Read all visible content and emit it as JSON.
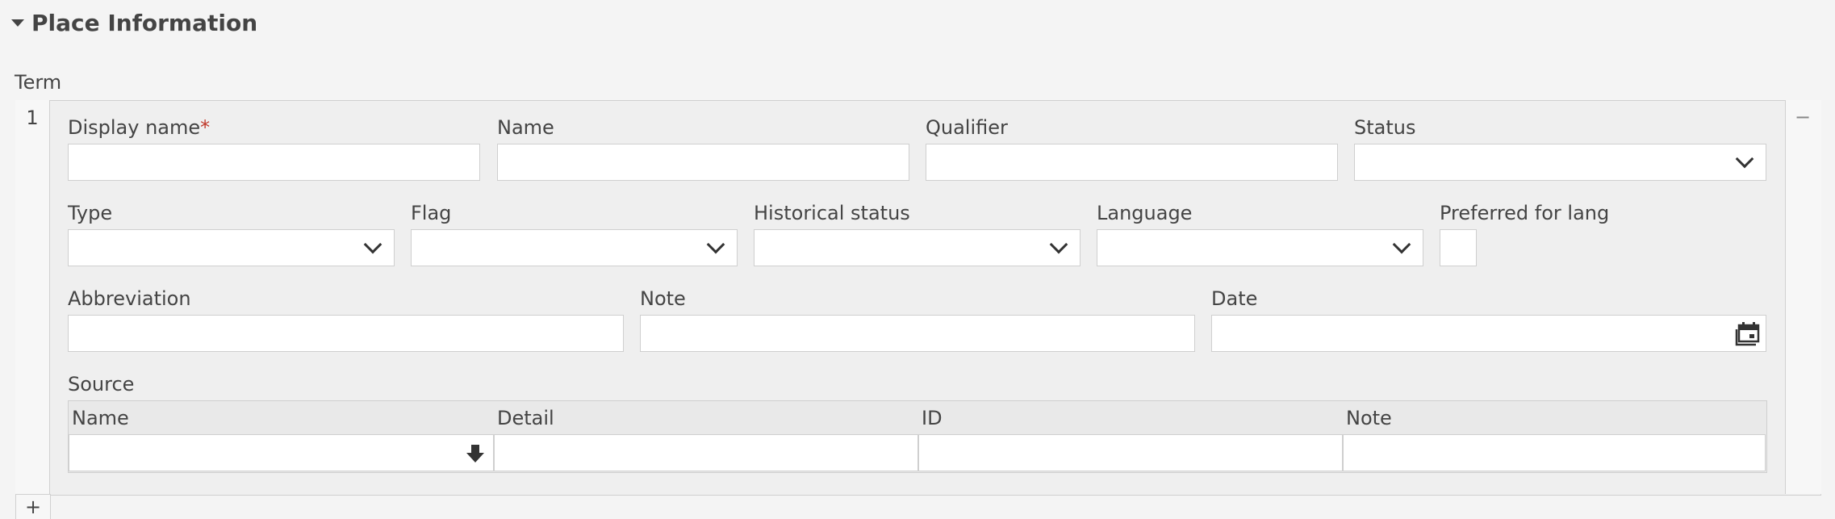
{
  "section": {
    "title": "Place Information"
  },
  "term": {
    "label": "Term",
    "row_number": "1",
    "remove_symbol": "−",
    "add_symbol": "+",
    "fields": {
      "display_name": "Display name",
      "required_marker": "*",
      "name": "Name",
      "qualifier": "Qualifier",
      "status": "Status",
      "type": "Type",
      "flag": "Flag",
      "historical_status": "Historical status",
      "language": "Language",
      "preferred_for_lang": "Preferred for lang",
      "abbreviation": "Abbreviation",
      "note": "Note",
      "date": "Date"
    },
    "source": {
      "label": "Source",
      "columns": [
        "Name",
        "Detail",
        "ID",
        "Note"
      ]
    }
  },
  "icons": {
    "dropdown": "chevron-down-icon",
    "calendar": "calendar-icon",
    "autocomplete": "download-arrow-icon"
  }
}
